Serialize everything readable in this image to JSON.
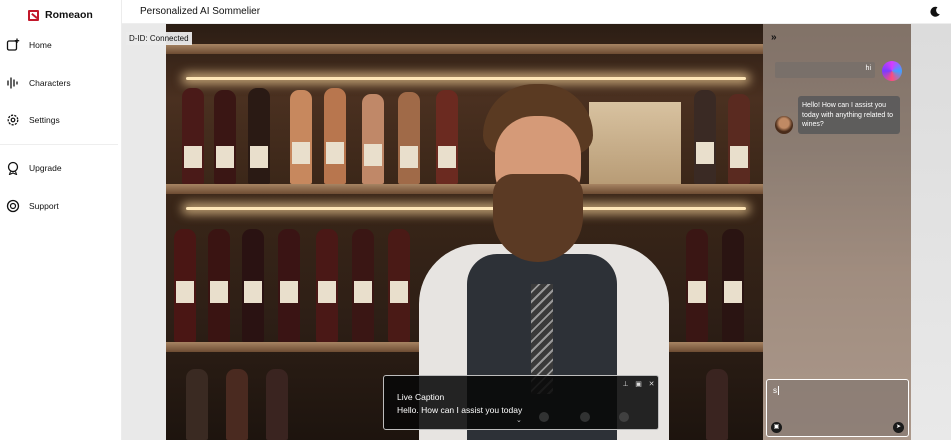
{
  "sidebar": {
    "brand": "Romeaon",
    "items": [
      {
        "label": "Home",
        "icon": "home-plus-icon"
      },
      {
        "label": "Characters",
        "icon": "waveform-icon"
      },
      {
        "label": "Settings",
        "icon": "gear-icon"
      },
      {
        "label": "Upgrade",
        "icon": "upgrade-icon"
      },
      {
        "label": "Support",
        "icon": "lifebuoy-icon"
      }
    ]
  },
  "header": {
    "title": "Personalized AI Sommelier",
    "theme_icon": "moon-icon"
  },
  "video": {
    "status": "D-ID: Connected"
  },
  "caption": {
    "title": "Live Caption",
    "text": "Hello. How can I assist you today"
  },
  "chat": {
    "collapse_label": "»",
    "user_message": "hi",
    "bot_message": "Hello! How can I assist you today with anything related to wines?",
    "input_value": "s"
  },
  "colors": {
    "brand": "#c2182b",
    "caption_bg": "#080808"
  }
}
